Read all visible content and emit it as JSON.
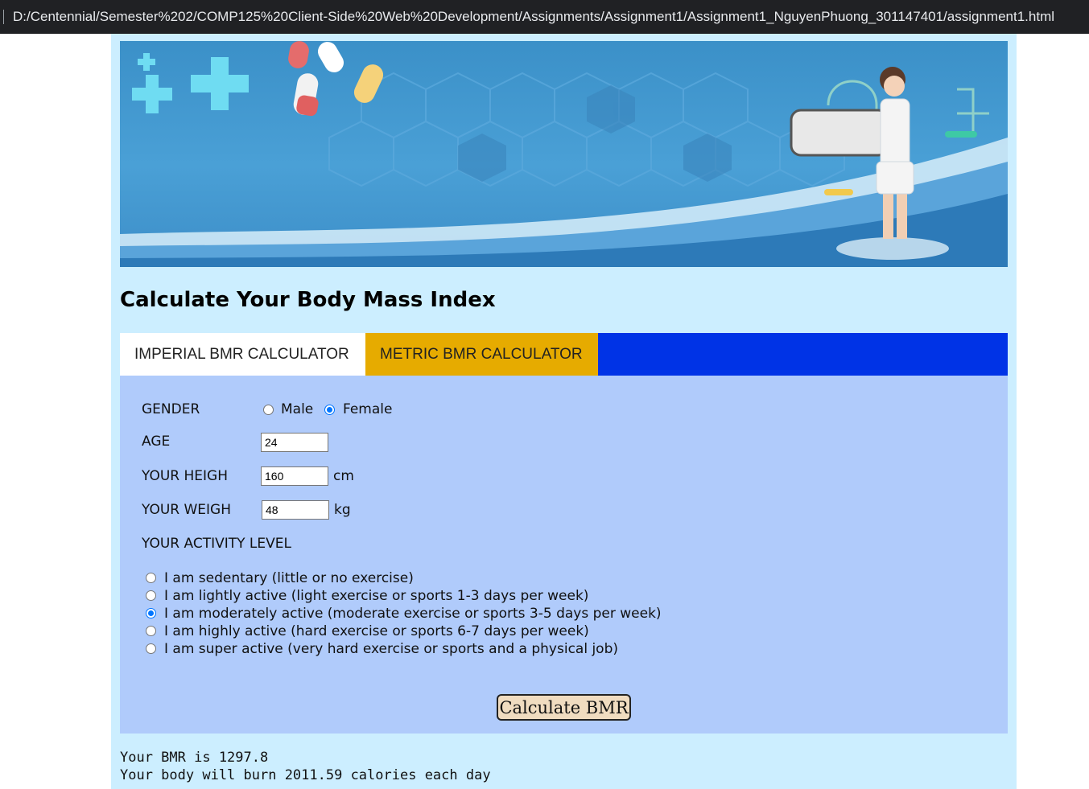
{
  "browser": {
    "address": "D:/Centennial/Semester%202/COMP125%20Client-Side%20Web%20Development/Assignments/Assignment1/Assignment1_NguyenPhuong_301147401/assignment1.html"
  },
  "page": {
    "title": "Calculate Your Body Mass Index"
  },
  "tabs": [
    {
      "label": "IMPERIAL BMR CALCULATOR",
      "active": false
    },
    {
      "label": "METRIC BMR CALCULATOR",
      "active": true
    }
  ],
  "form": {
    "gender": {
      "label": "GENDER",
      "options": [
        {
          "label": "Male",
          "checked": false
        },
        {
          "label": "Female",
          "checked": true
        }
      ]
    },
    "age": {
      "label": "AGE",
      "value": "24"
    },
    "height": {
      "label": "YOUR HEIGH",
      "value": "160",
      "unit": "cm"
    },
    "weight": {
      "label": "YOUR WEIGH",
      "value": "48",
      "unit": "kg"
    },
    "activity": {
      "label": "YOUR ACTIVITY LEVEL",
      "options": [
        {
          "label": "I am sedentary (little or no exercise)",
          "checked": false
        },
        {
          "label": "I am lightly active (light exercise or sports 1-3 days per week)",
          "checked": false
        },
        {
          "label": "I am moderately active (moderate exercise or sports 3-5 days per week)",
          "checked": true
        },
        {
          "label": "I am highly active (hard exercise or sports 6-7 days per week)",
          "checked": false
        },
        {
          "label": "I am super active (very hard exercise or sports and a physical job)",
          "checked": false
        }
      ]
    },
    "submit_label": "Calculate BMR"
  },
  "results": {
    "bmr_line": "Your BMR is 1297.8",
    "calories_line": "Your body will burn 2011.59 calories each day"
  },
  "colors": {
    "page_bg": "#cceeff",
    "tab_bar": "#0033e6",
    "tab_active": "#e6ab00",
    "form_bg": "#b0cbfb",
    "button_bg": "#f0dcc0"
  }
}
